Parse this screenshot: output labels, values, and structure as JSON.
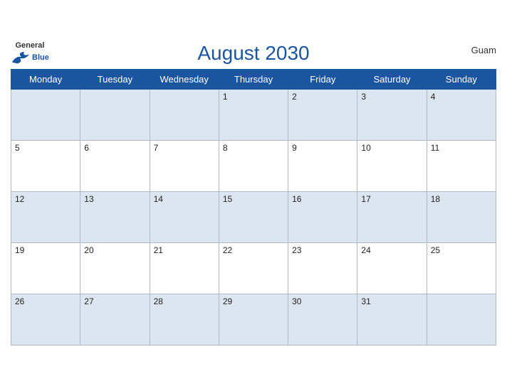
{
  "header": {
    "title": "August 2030",
    "region": "Guam",
    "logo": {
      "general": "General",
      "blue": "Blue"
    }
  },
  "weekdays": [
    "Monday",
    "Tuesday",
    "Wednesday",
    "Thursday",
    "Friday",
    "Saturday",
    "Sunday"
  ],
  "weeks": [
    [
      null,
      null,
      null,
      1,
      2,
      3,
      4
    ],
    [
      5,
      6,
      7,
      8,
      9,
      10,
      11
    ],
    [
      12,
      13,
      14,
      15,
      16,
      17,
      18
    ],
    [
      19,
      20,
      21,
      22,
      23,
      24,
      25
    ],
    [
      26,
      27,
      28,
      29,
      30,
      31,
      null
    ]
  ]
}
